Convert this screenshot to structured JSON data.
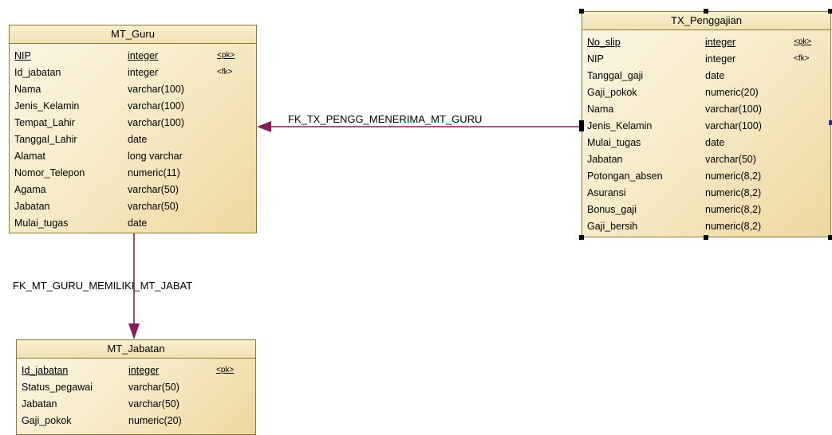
{
  "entities": {
    "mt_guru": {
      "title": "MT_Guru",
      "attributes": [
        {
          "name": "NIP",
          "type": "integer",
          "key": "<pk>",
          "pk": true
        },
        {
          "name": "Id_jabatan",
          "type": "integer",
          "key": "<fk>",
          "pk": false
        },
        {
          "name": "Nama",
          "type": "varchar(100)",
          "key": "",
          "pk": false
        },
        {
          "name": "Jenis_Kelamin",
          "type": "varchar(100)",
          "key": "",
          "pk": false
        },
        {
          "name": "Tempat_Lahir",
          "type": "varchar(100)",
          "key": "",
          "pk": false
        },
        {
          "name": "Tanggal_Lahir",
          "type": "date",
          "key": "",
          "pk": false
        },
        {
          "name": "Alamat",
          "type": "long varchar",
          "key": "",
          "pk": false
        },
        {
          "name": "Nomor_Telepon",
          "type": "numeric(11)",
          "key": "",
          "pk": false
        },
        {
          "name": "Agama",
          "type": "varchar(50)",
          "key": "",
          "pk": false
        },
        {
          "name": "Jabatan",
          "type": "varchar(50)",
          "key": "",
          "pk": false
        },
        {
          "name": "Mulai_tugas",
          "type": "date",
          "key": "",
          "pk": false
        }
      ]
    },
    "tx_penggajian": {
      "title": "TX_Penggajian",
      "attributes": [
        {
          "name": "No_slip",
          "type": "integer",
          "key": "<pk>",
          "pk": true
        },
        {
          "name": "NIP",
          "type": "integer",
          "key": "<fk>",
          "pk": false
        },
        {
          "name": "Tanggal_gaji",
          "type": "date",
          "key": "",
          "pk": false
        },
        {
          "name": "Gaji_pokok",
          "type": "numeric(20)",
          "key": "",
          "pk": false
        },
        {
          "name": "Nama",
          "type": "varchar(100)",
          "key": "",
          "pk": false
        },
        {
          "name": "Jenis_Kelamin",
          "type": "varchar(100)",
          "key": "",
          "pk": false
        },
        {
          "name": "Mulai_tugas",
          "type": "date",
          "key": "",
          "pk": false
        },
        {
          "name": "Jabatan",
          "type": "varchar(50)",
          "key": "",
          "pk": false
        },
        {
          "name": "Potongan_absen",
          "type": "numeric(8,2)",
          "key": "",
          "pk": false
        },
        {
          "name": "Asuransi",
          "type": "numeric(8,2)",
          "key": "",
          "pk": false
        },
        {
          "name": "Bonus_gaji",
          "type": "numeric(8,2)",
          "key": "",
          "pk": false
        },
        {
          "name": "Gaji_bersih",
          "type": "numeric(8,2)",
          "key": "",
          "pk": false
        }
      ]
    },
    "mt_jabatan": {
      "title": "MT_Jabatan",
      "attributes": [
        {
          "name": "Id_jabatan",
          "type": "integer",
          "key": "<pk>",
          "pk": true
        },
        {
          "name": "Status_pegawai",
          "type": "varchar(50)",
          "key": "",
          "pk": false
        },
        {
          "name": "Jabatan",
          "type": "varchar(50)",
          "key": "",
          "pk": false
        },
        {
          "name": "Gaji_pokok",
          "type": "numeric(20)",
          "key": "",
          "pk": false
        }
      ]
    }
  },
  "relationships": {
    "rel1": {
      "label": "FK_TX_PENGG_MENERIMA_MT_GURU"
    },
    "rel2": {
      "label": "FK_MT_GURU_MEMILIKI_MT_JABAT"
    }
  },
  "colors": {
    "connector": "#8b1a5a",
    "entity_border": "#8a7a3a"
  }
}
